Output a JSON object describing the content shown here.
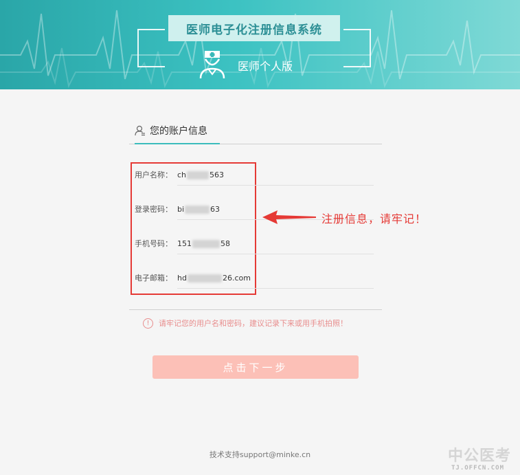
{
  "header": {
    "title": "医师电子化注册信息系统",
    "subtitle": "医师个人版"
  },
  "tab": {
    "label": "您的账户信息"
  },
  "account": {
    "rows": [
      {
        "label": "用户名称：",
        "value_start": "ch",
        "value_end": "563"
      },
      {
        "label": "登录密码：",
        "value_start": "bi",
        "value_end": "63"
      },
      {
        "label": "手机号码：",
        "value_start": "151",
        "value_end": "58"
      },
      {
        "label": "电子邮箱：",
        "value_start": "hd",
        "value_end": "26.com"
      }
    ]
  },
  "annotation": {
    "text": "注册信息，请牢记！"
  },
  "warning": {
    "icon": "!",
    "text": "请牢记您的用户名和密码，建议记录下来或用手机拍照！"
  },
  "next_button": {
    "label": "点击下一步"
  },
  "footer": {
    "text": "技术支持support@minke.cn"
  },
  "watermark": {
    "brand": "中公医考",
    "url": "TJ.OFFCN.COM"
  },
  "colors": {
    "accent": "#3bbcbc",
    "red": "#e53935",
    "button": "#fcc0b7",
    "warning": "#e88d8d"
  }
}
